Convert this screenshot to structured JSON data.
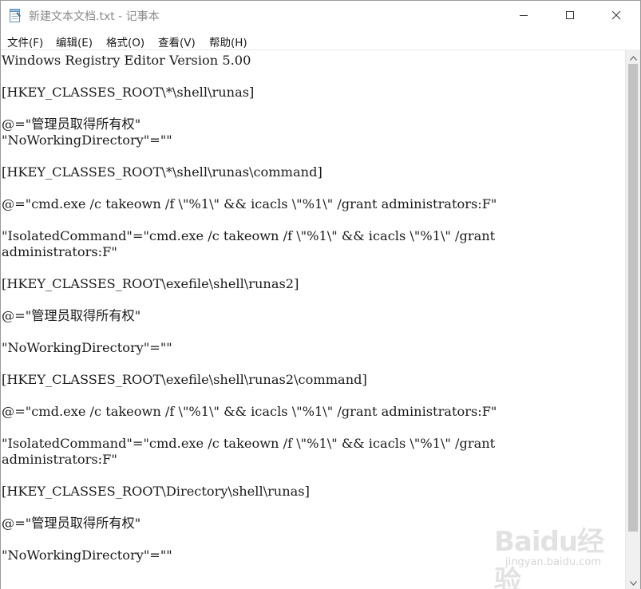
{
  "window": {
    "title": "新建文本文档.txt - 记事本"
  },
  "menu": {
    "items": [
      {
        "label": "文件(F)"
      },
      {
        "label": "编辑(E)"
      },
      {
        "label": "格式(O)"
      },
      {
        "label": "查看(V)"
      },
      {
        "label": "帮助(H)"
      }
    ]
  },
  "editor": {
    "lines": [
      "Windows Registry Editor Version 5.00",
      "[HKEY_CLASSES_ROOT\\*\\shell\\runas]",
      "@=\"管理员取得所有权\"",
      "\"NoWorkingDirectory\"=\"\"",
      "[HKEY_CLASSES_ROOT\\*\\shell\\runas\\command]",
      "@=\"cmd.exe /c takeown /f \\\"%1\\\" && icacls \\\"%1\\\" /grant administrators:F\"",
      "\"IsolatedCommand\"=\"cmd.exe /c takeown /f \\\"%1\\\" && icacls \\\"%1\\\" /grant",
      "administrators:F\"",
      "[HKEY_CLASSES_ROOT\\exefile\\shell\\runas2]",
      "@=\"管理员取得所有权\"",
      "\"NoWorkingDirectory\"=\"\"",
      "[HKEY_CLASSES_ROOT\\exefile\\shell\\runas2\\command]",
      "@=\"cmd.exe /c takeown /f \\\"%1\\\" && icacls \\\"%1\\\" /grant administrators:F\"",
      "\"IsolatedCommand\"=\"cmd.exe /c takeown /f \\\"%1\\\" && icacls \\\"%1\\\" /grant",
      "administrators:F\"",
      "[HKEY_CLASSES_ROOT\\Directory\\shell\\runas]",
      "@=\"管理员取得所有权\"",
      "\"NoWorkingDirectory\"=\"\""
    ]
  },
  "watermark": {
    "brand": "Baidu经验",
    "url": "jingyan.baidu.com"
  },
  "icons": {
    "app": "notepad-icon",
    "minimize": "minimize-icon",
    "maximize": "maximize-icon",
    "close": "close-icon",
    "scroll_up": "scroll-up-arrow-icon",
    "scroll_down": "scroll-down-arrow-icon"
  }
}
